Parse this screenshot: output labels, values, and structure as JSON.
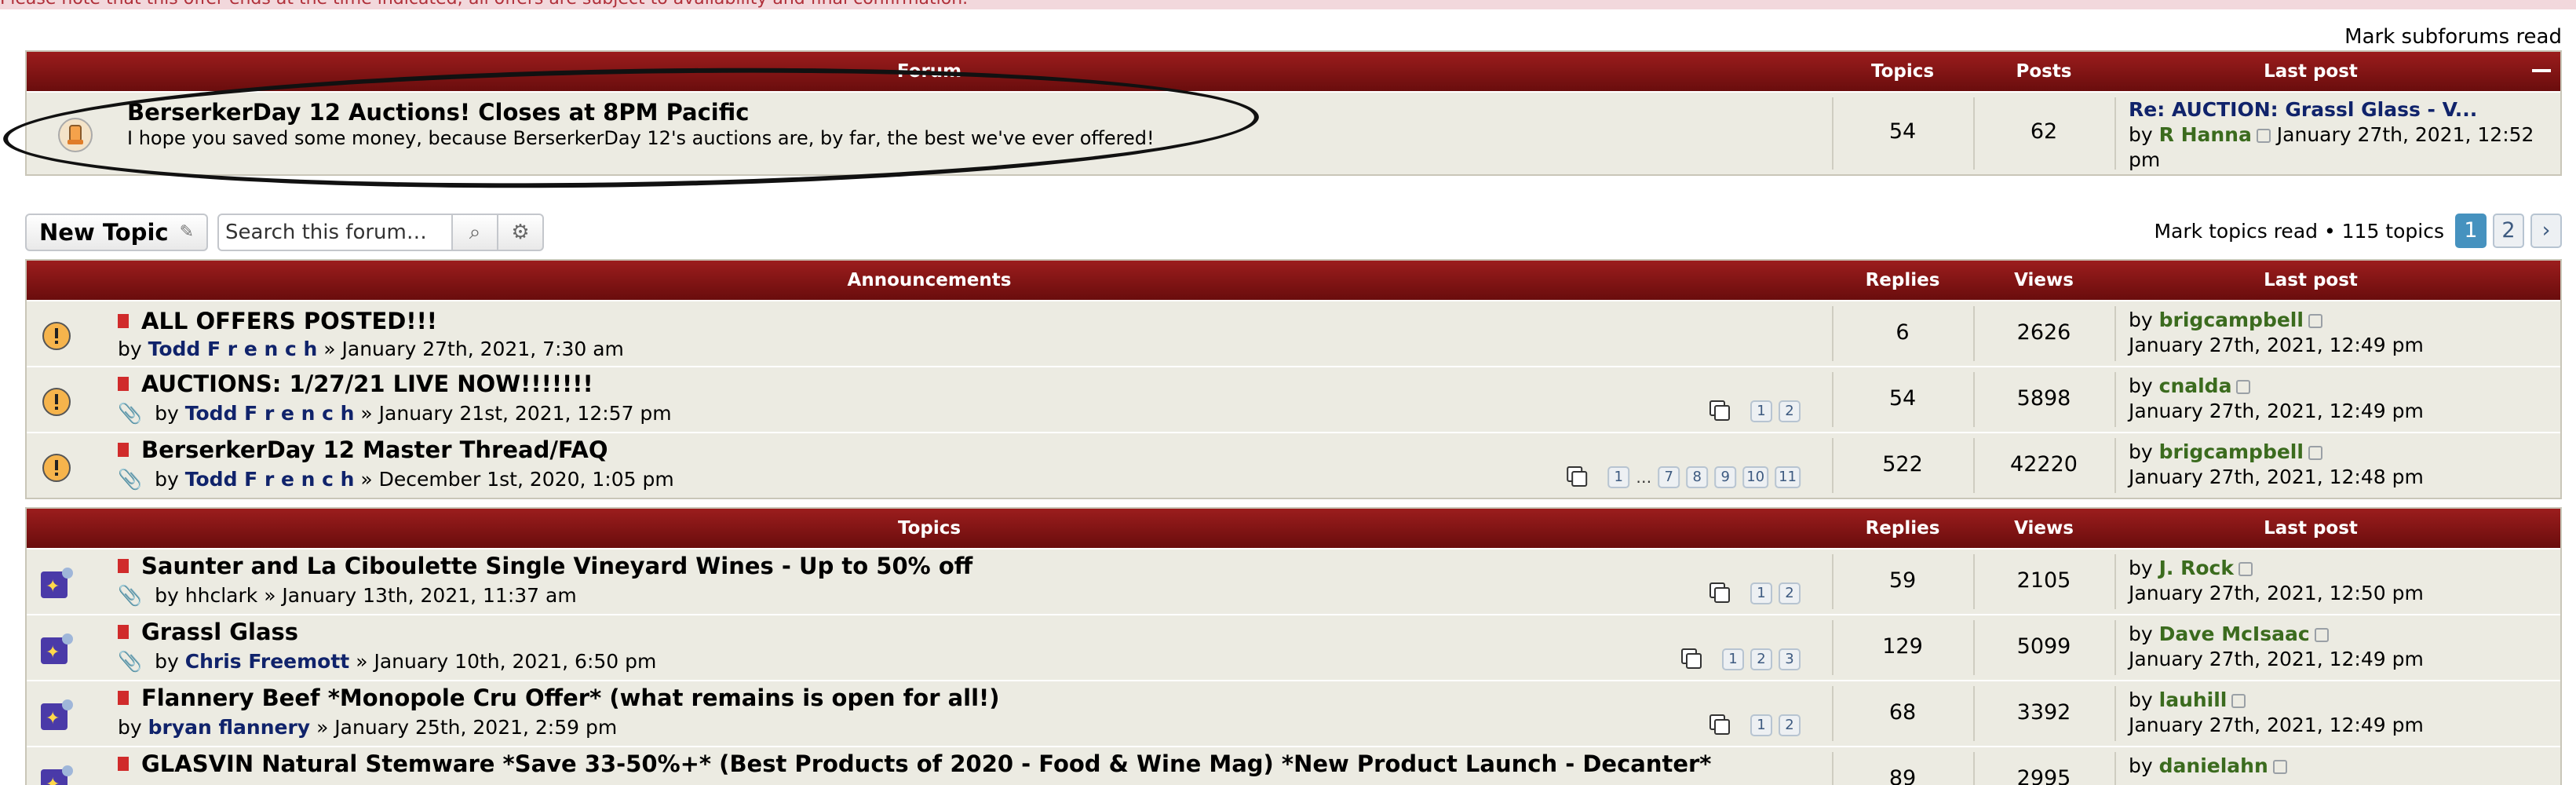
{
  "notice": "Please note that this offer ends at the time indicated; all offers are subject to availability and final confirmation.",
  "mark_subforums": "Mark subforums read",
  "forum_table": {
    "headers": {
      "forum": "Forum",
      "topics": "Topics",
      "posts": "Posts",
      "last_post": "Last post"
    },
    "row": {
      "title": "BerserkerDay 12 Auctions! Closes at 8PM Pacific",
      "desc": "I hope you saved some money, because BerserkerDay 12's auctions are, by far, the best we've ever offered!",
      "topics": "54",
      "posts": "62",
      "last_title": "Re: AUCTION: Grassl Glass - V...",
      "last_by_prefix": "by",
      "last_user": "R Hanna",
      "last_date": "January 27th, 2021, 12:52",
      "last_date2": "pm"
    }
  },
  "toolbar": {
    "new_topic": "New Topic",
    "search_placeholder": "Search this forum…",
    "mark_topics": "Mark topics read • 115 topics",
    "pages": [
      "1",
      "2"
    ]
  },
  "announcements": {
    "headers": {
      "title": "Announcements",
      "replies": "Replies",
      "views": "Views",
      "last_post": "Last post"
    },
    "rows": [
      {
        "title": "ALL OFFERS POSTED!!!",
        "author": "Todd F r e n c h",
        "date": "» January 27th, 2021, 7:30 am",
        "replies": "6",
        "views": "2626",
        "last_user": "brigcampbell",
        "last_date": "January 27th, 2021, 12:49 pm"
      },
      {
        "title": "AUCTIONS: 1/27/21 LIVE NOW!!!!!!!",
        "author": "Todd F r e n c h",
        "date": "» January 21st, 2021, 12:57 pm",
        "replies": "54",
        "views": "5898",
        "last_user": "cnalda",
        "last_date": "January 27th, 2021, 12:49 pm",
        "pages": [
          "1",
          "2"
        ]
      },
      {
        "title": "BerserkerDay 12 Master Thread/FAQ",
        "author": "Todd F r e n c h",
        "date": "» December 1st, 2020, 1:05 pm",
        "replies": "522",
        "views": "42220",
        "last_user": "brigcampbell",
        "last_date": "January 27th, 2021, 12:48 pm",
        "pages": [
          "1",
          "…",
          "7",
          "8",
          "9",
          "10",
          "11"
        ]
      }
    ]
  },
  "topics": {
    "headers": {
      "title": "Topics",
      "replies": "Replies",
      "views": "Views",
      "last_post": "Last post"
    },
    "rows": [
      {
        "title": "Saunter and La Ciboulette Single Vineyard Wines - Up to 50% off",
        "author": "hhclark",
        "date": "» January 13th, 2021, 11:37 am",
        "replies": "59",
        "views": "2105",
        "last_user": "J. Rock",
        "last_date": "January 27th, 2021, 12:50 pm",
        "pages": [
          "1",
          "2"
        ]
      },
      {
        "title": "Grassl Glass",
        "author": "Chris Freemott",
        "date": "» January 10th, 2021, 6:50 pm",
        "replies": "129",
        "views": "5099",
        "last_user": "Dave McIsaac",
        "last_date": "January 27th, 2021, 12:49 pm",
        "pages": [
          "1",
          "2",
          "3"
        ]
      },
      {
        "title": "Flannery Beef *Monopole Cru Offer* (what remains is open for all!)",
        "author": "bryan flannery",
        "date": "» January 25th, 2021, 2:59 pm",
        "replies": "68",
        "views": "3392",
        "last_user": "lauhill",
        "last_date": "January 27th, 2021, 12:49 pm",
        "pages": [
          "1",
          "2"
        ]
      },
      {
        "title": "GLASVIN Natural Stemware *Save 33-50%+* (Best Products of 2020 - Food & Wine Mag) *New Product Launch - Decanter*",
        "replies": "89",
        "views": "2995",
        "last_user": "danielahn"
      }
    ]
  },
  "by_label": "by"
}
